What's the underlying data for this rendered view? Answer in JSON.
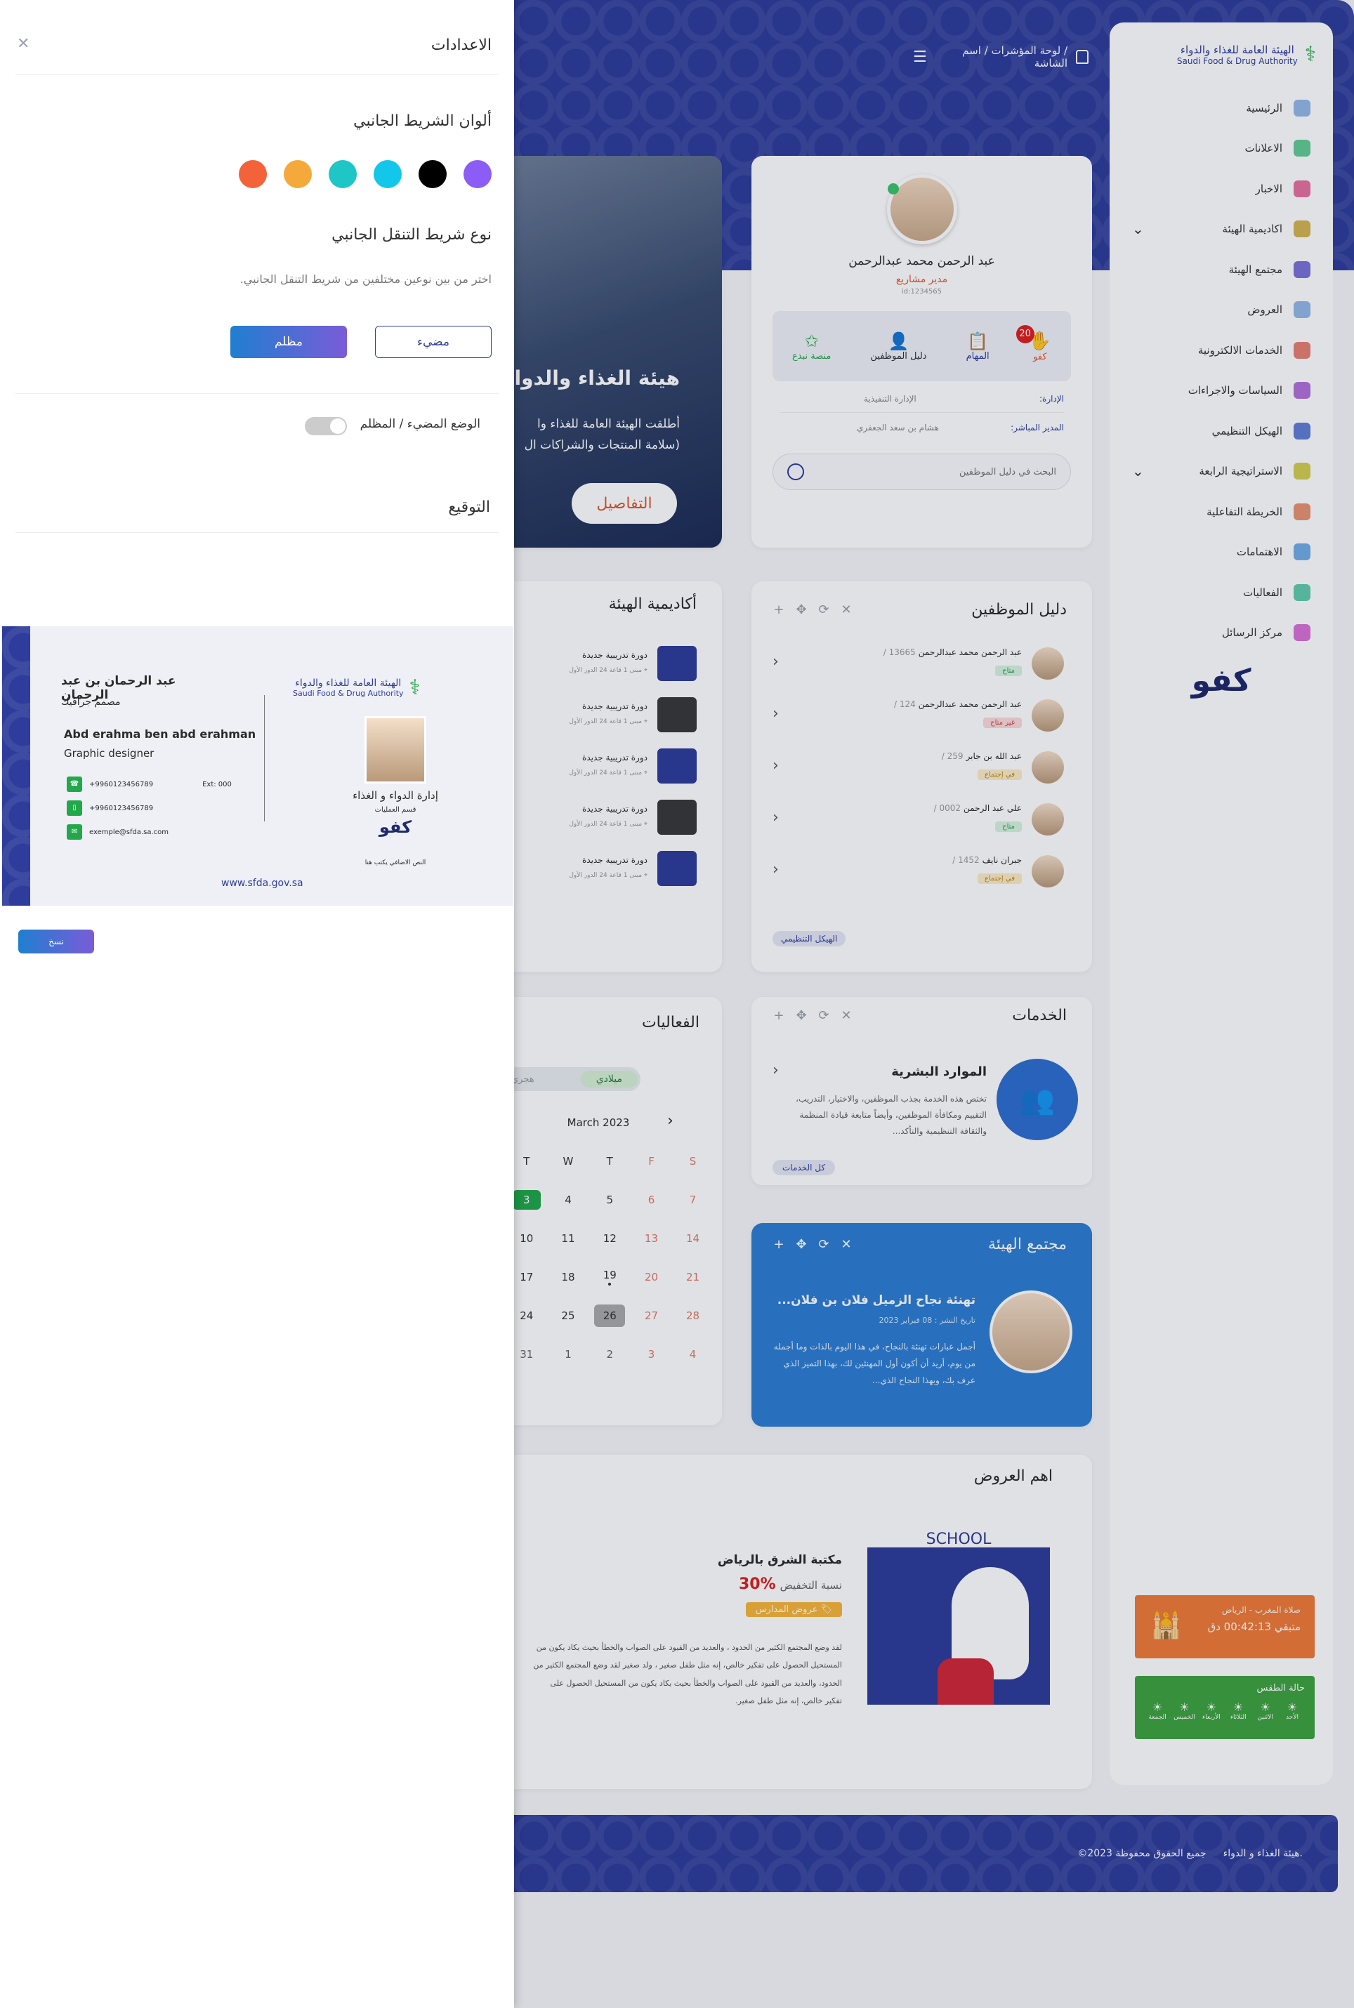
{
  "settings": {
    "title": "الاعدادات",
    "sidebar_colors_heading": "ألوان الشريط الجانبي",
    "colors": [
      "#8b5cf6",
      "#000000",
      "#13c7ea",
      "#1fc6c6",
      "#f6a93b",
      "#f4623a"
    ],
    "nav_type_heading": "نوع شريط التنقل الجانبي",
    "nav_type_desc": "اختر من بين نوعين مختلفين من شريط التنقل الجانبي.",
    "light_label": "مضيء",
    "dark_label": "مظلم",
    "mode_label": "الوضع المضيء / المظلم",
    "signature_heading": "التوقيع",
    "copy_label": "نسخ"
  },
  "signature": {
    "name_ar": "عبد الرحمان بن عبد الرحمان",
    "title_ar": "مصمم جرافيك",
    "name_en": "Abd erahma ben abd erahman",
    "title_en": "Graphic designer",
    "phone1": "+9960123456789",
    "ext": "Ext: 000",
    "phone2": "+9960123456789",
    "email": "exemple@sfda.sa.com",
    "website": "www.sfda.gov.sa",
    "org_ar": "الهيئة العامة للغذاء والدواء",
    "org_en": "Saudi Food & Drug Authority",
    "dept_main": "إدارة الدواء و الغذاء",
    "dept_sub": "قسم العمليات",
    "kafo": "كفو",
    "note": "النص الاضافي يكتب هنا"
  },
  "header": {
    "breadcrumb": "/ لوحة المؤشرات / اسم الشاشة"
  },
  "brand": {
    "ar": "الهيئة العامة للغذاء والدواء",
    "en": "Saudi Food & Drug Authority"
  },
  "nav": [
    {
      "label": "الرئيسية",
      "color": "#7aa7e0"
    },
    {
      "label": "الاعلانات",
      "color": "#3bbf7a"
    },
    {
      "label": "الاخبار",
      "color": "#e04f8a"
    },
    {
      "label": "اكاديمية الهيئة",
      "color": "#c9a227",
      "chev": "⌄"
    },
    {
      "label": "مجتمع الهيئة",
      "color": "#5a4fcf"
    },
    {
      "label": "العروض",
      "color": "#7aa7e0"
    },
    {
      "label": "الخدمات الالكترونية",
      "color": "#e0604f"
    },
    {
      "label": "السياسات والاجراءات",
      "color": "#a04fcf"
    },
    {
      "label": "الهيكل التنظيمي",
      "color": "#3a5fc9"
    },
    {
      "label": "الاستراتيجية الرابعة",
      "color": "#c9c227",
      "chev": "⌄"
    },
    {
      "label": "الخريطة التفاعلية",
      "color": "#e07a4f"
    },
    {
      "label": "الاهتمامات",
      "color": "#4f9ae0"
    },
    {
      "label": "الفعاليات",
      "color": "#3bbf9a"
    },
    {
      "label": "مركز الرسائل",
      "color": "#cf4fcf"
    }
  ],
  "kafo_logo": "كفو",
  "prayer": {
    "title": "صلاة المغرب - الرياض",
    "time": "متبقي 00:42:13 دق"
  },
  "weather": {
    "title": "حالة الطقس",
    "days": [
      "الأحد",
      "الاثنين",
      "الثلاثاء",
      "الأربعاء",
      "الخميس",
      "الجمعة"
    ]
  },
  "profile": {
    "name": "عبد الرحمن محمد عبدالرحمن",
    "role": "مدير مشاريع",
    "id": "id:1234565",
    "tabs": [
      "كفو",
      "المهام",
      "دليل الموظفين",
      "منصة نبدع"
    ],
    "kafo_badge": "20",
    "dept_label": "الإدارة:",
    "dept_value": "الإدارة التنفيذية",
    "mgr_label": "المدير المباشر:",
    "mgr_value": "هشام بن سعد الجعفري",
    "search_placeholder": "البحث في دليل الموظفين"
  },
  "banner": {
    "title": "هيئة الغذاء والدواء",
    "line1": "أطلقت الهيئة العامة للغذاء وا",
    "line2": "(سلامة المنتجات والشراكات ال",
    "btn": "التفاصيل"
  },
  "directory": {
    "title": "دليل الموظفين",
    "rows": [
      {
        "name": "عبد الرحمن محمد عبدالرحمن",
        "num": "13665 /",
        "status": "متاح",
        "kind": "g"
      },
      {
        "name": "عبد الرحمن محمد عبدالرحمن",
        "num": "124 /",
        "status": "غير متاح",
        "kind": "r"
      },
      {
        "name": "عبد الله بن جابر",
        "num": "259 /",
        "status": "في إجتماع",
        "kind": "y"
      },
      {
        "name": "علي عبد الرحمن",
        "num": "0002 /",
        "status": "متاح",
        "kind": "g"
      },
      {
        "name": "جبران نايف",
        "num": "1452 /",
        "status": "في إجتماع",
        "kind": "y"
      }
    ],
    "org_btn": "الهيكل التنظيمي"
  },
  "academy": {
    "title": "أكاديمية الهيئة",
    "items": [
      {
        "title": "دورة تدريبية جديدة",
        "meta": "مبنى 1 قاعة 24 الدور الأول"
      },
      {
        "title": "دورة تدريبية جديدة",
        "meta": "مبنى 1 قاعة 24 الدور الأول"
      },
      {
        "title": "دورة تدريبية جديدة",
        "meta": "مبنى 1 قاعة 24 الدور الأول"
      },
      {
        "title": "دورة تدريبية جديدة",
        "meta": "مبنى 1 قاعة 24 الدور الأول"
      },
      {
        "title": "دورة تدريبية جديدة",
        "meta": "مبنى 1 قاعة 24 الدور الأول"
      }
    ]
  },
  "services": {
    "title": "الخدمات",
    "card_title": "الموارد البشرية",
    "desc": "تختص هذه الخدمة بجذب الموظفين، والاختيار، التدريب، التقييم ومكافأة الموظفين، وأيضاً متابعة قيادة المنظمة والثقافة التنظيمية والتأكد...",
    "all_btn": "كل الخدمات"
  },
  "events": {
    "title": "الفعاليات",
    "greg": "ميلادي",
    "hijri": "هجري",
    "month": "March 2023",
    "days": [
      "T",
      "W",
      "T",
      "F",
      "S"
    ],
    "weeks": [
      [
        "3",
        "4",
        "5",
        "6",
        "7"
      ],
      [
        "10",
        "11",
        "12",
        "13",
        "14"
      ],
      [
        "17",
        "18",
        "19",
        "20",
        "21"
      ],
      [
        "24",
        "25",
        "26",
        "27",
        "28"
      ],
      [
        "31",
        "1",
        "2",
        "3",
        "4"
      ]
    ]
  },
  "community": {
    "title": "مجتمع الهيئة",
    "headline": "تهنئة نجاح الزميل فلان بن فلان...",
    "date": "تاريخ النشر : 08 فبراير 2023",
    "body": "أجمل عبارات تهنئة بالنجاح، في هذا اليوم بالذات وما أجمله من يوم، أريد أن أكون أول المهنئين لك، بهذا التميز الذي عرف بك، وبهذا النجاح الذي..."
  },
  "offers": {
    "title": "اهم العروض",
    "name": "مكتبة الشرق بالرياض",
    "discount_label": "نسبة التخفيض",
    "discount": "30%",
    "tag": "عروض المدارس",
    "body": "لقد وضع المجتمع الكثير من الحدود ، والعديد من القيود على الصواب والخطأ بحيث يكاد يكون من المستحيل الحصول على تفكير خالص، إنه مثل طفل صغير ، ولد صغير لقد وضع المجتمع الكثير من الحدود، والعديد من القيود على الصواب والخطأ بحيث يكاد يكون من المستحيل الحصول على تفكير خالص، إنه مثل طفل صغير.",
    "school": "SCHOOL"
  },
  "footer": {
    "org": "هيئة الغذاء و الدواء.",
    "rights": "©جميع الحقوق محفوظة 2023"
  }
}
